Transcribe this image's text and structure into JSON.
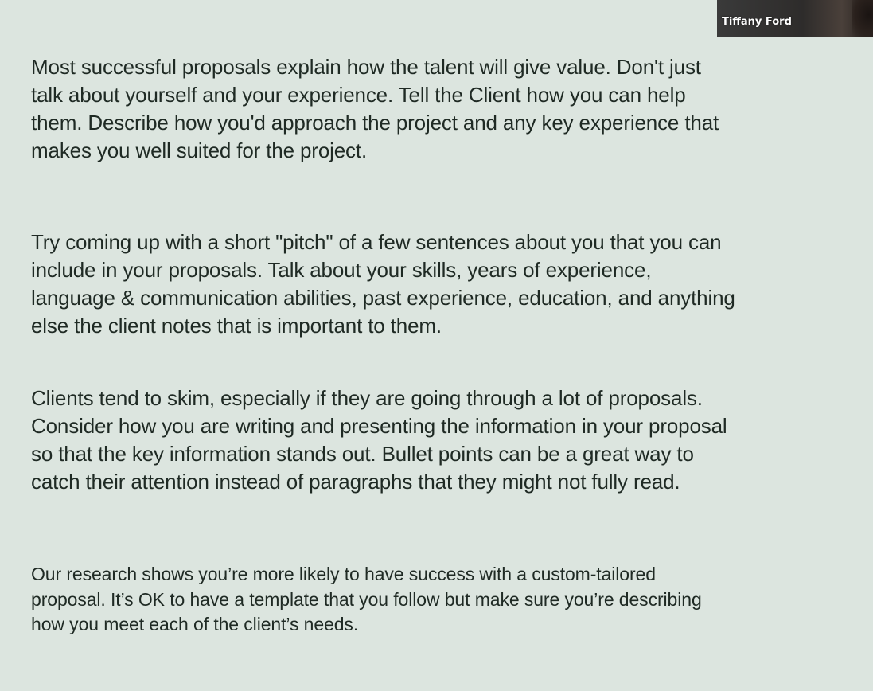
{
  "participant": {
    "name": "Tiffany Ford"
  },
  "slide": {
    "paragraphs": [
      "Most successful proposals explain how the talent will give value. Don't just\ntalk about yourself and your experience. Tell the Client how you can help\nthem. Describe how you'd approach the project and any key experience that\nmakes you well suited for the project.",
      "Try coming up with a short \"pitch\" of a few sentences about you that you can\ninclude in your proposals. Talk about your skills, years of experience,\nlanguage & communication abilities, past experience, education, and anything\nelse the client notes that is important to them.",
      "Clients tend to skim, especially if they are going through a lot of proposals.\nConsider how you are writing and presenting the information in your proposal\nso that the key information stands out. Bullet points can be a great way to\ncatch their attention instead of paragraphs that they might not fully read.",
      "Our research shows you’re more likely to have success with a custom-tailored\nproposal. It’s OK to have a template that you follow but make sure you’re describing\nhow you meet each of the client’s needs."
    ]
  },
  "colors": {
    "background": "#dce5df",
    "text": "#1f2a24",
    "name_label": "#ffffff"
  }
}
